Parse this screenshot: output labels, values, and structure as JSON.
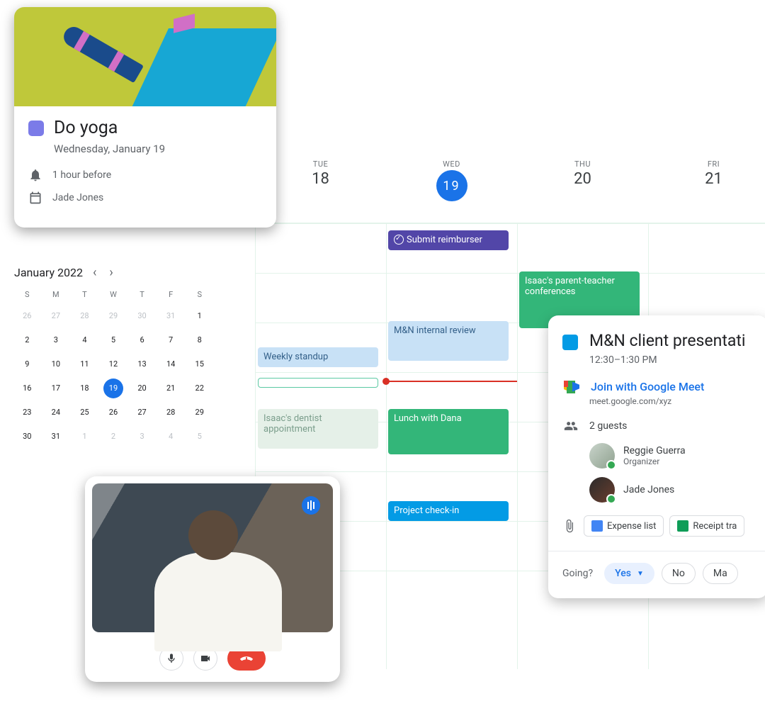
{
  "yoga": {
    "title": "Do yoga",
    "date": "Wednesday, January 19",
    "reminder": "1 hour before",
    "owner": "Jade Jones"
  },
  "mini_month": {
    "label": "January 2022",
    "dow": [
      "S",
      "M",
      "T",
      "W",
      "T",
      "F",
      "S"
    ],
    "cells": [
      {
        "n": "26",
        "dim": true
      },
      {
        "n": "27",
        "dim": true
      },
      {
        "n": "28",
        "dim": true
      },
      {
        "n": "29",
        "dim": true
      },
      {
        "n": "30",
        "dim": true
      },
      {
        "n": "31",
        "dim": true
      },
      {
        "n": "1"
      },
      {
        "n": "2"
      },
      {
        "n": "3"
      },
      {
        "n": "4"
      },
      {
        "n": "5"
      },
      {
        "n": "6"
      },
      {
        "n": "7"
      },
      {
        "n": "8"
      },
      {
        "n": "9"
      },
      {
        "n": "10"
      },
      {
        "n": "11"
      },
      {
        "n": "12"
      },
      {
        "n": "13"
      },
      {
        "n": "14"
      },
      {
        "n": "15"
      },
      {
        "n": "16"
      },
      {
        "n": "17"
      },
      {
        "n": "18"
      },
      {
        "n": "19",
        "today": true
      },
      {
        "n": "20"
      },
      {
        "n": "21"
      },
      {
        "n": "22"
      },
      {
        "n": "23"
      },
      {
        "n": "24"
      },
      {
        "n": "25"
      },
      {
        "n": "26"
      },
      {
        "n": "27"
      },
      {
        "n": "28"
      },
      {
        "n": "29"
      },
      {
        "n": "30"
      },
      {
        "n": "31"
      },
      {
        "n": "1",
        "dim": true
      },
      {
        "n": "2",
        "dim": true
      },
      {
        "n": "3",
        "dim": true
      },
      {
        "n": "4",
        "dim": true
      },
      {
        "n": "5",
        "dim": true
      }
    ]
  },
  "week": {
    "days": [
      {
        "dow": "TUE",
        "num": "18"
      },
      {
        "dow": "WED",
        "num": "19",
        "today": true
      },
      {
        "dow": "THU",
        "num": "20"
      },
      {
        "dow": "FRI",
        "num": "21"
      }
    ],
    "events": {
      "submit": "Submit reimburser",
      "parent_teacher": "Isaac's parent-teacher conferences",
      "internal_review": "M&N internal review",
      "standup": "Weekly standup",
      "dentist": "Isaac's dentist appointment",
      "lunch": "Lunch with Dana",
      "checkin": "Project check-in"
    }
  },
  "detail": {
    "title": "M&N client presentati",
    "time": "12:30–1:30 PM",
    "join": "Join with Google Meet",
    "meet_url": "meet.google.com/xyz",
    "guests_label": "2 guests",
    "guests": [
      {
        "name": "Reggie Guerra",
        "role": "Organizer"
      },
      {
        "name": "Jade Jones",
        "role": ""
      }
    ],
    "attachments": [
      {
        "label": "Expense list",
        "kind": "d"
      },
      {
        "label": "Receipt tra",
        "kind": "s"
      }
    ],
    "going_label": "Going?",
    "rsvp": {
      "yes": "Yes",
      "no": "No",
      "maybe": "Ma"
    }
  }
}
